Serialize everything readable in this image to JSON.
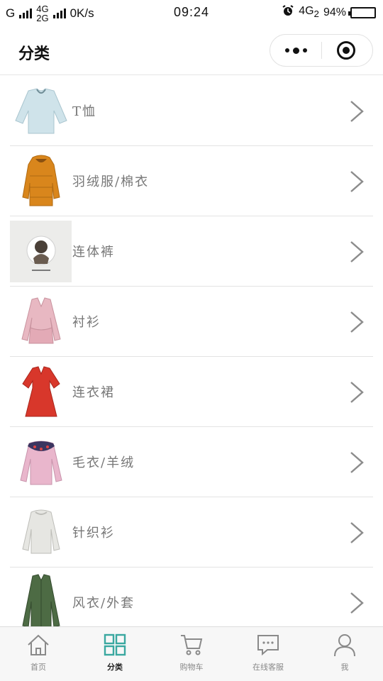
{
  "status_bar": {
    "carrier_left": "G",
    "net_top": "4G",
    "net_bottom": "2G",
    "speed": "0K/s",
    "time": "09:24",
    "net_right": "4G",
    "net_right_sub": "2",
    "battery_level": 0.94,
    "battery_text": "94%"
  },
  "header": {
    "title": "分类",
    "more_icon": "more-dots-icon",
    "close_icon": "target-close-icon"
  },
  "categories": [
    {
      "label": "T恤",
      "icon": "tshirt-thumbnail"
    },
    {
      "label": "羽绒服/棉衣",
      "icon": "down-jacket-thumbnail"
    },
    {
      "label": "连体裤",
      "icon": "jumpsuit-thumbnail"
    },
    {
      "label": "衬衫",
      "icon": "shirt-thumbnail"
    },
    {
      "label": "连衣裙",
      "icon": "dress-thumbnail"
    },
    {
      "label": "毛衣/羊绒",
      "icon": "sweater-thumbnail"
    },
    {
      "label": "针织衫",
      "icon": "knitwear-thumbnail"
    },
    {
      "label": "风衣/外套",
      "icon": "coat-thumbnail"
    }
  ],
  "tabbar": [
    {
      "label": "首页",
      "icon": "home-icon",
      "active": false
    },
    {
      "label": "分类",
      "icon": "category-grid-icon",
      "active": true
    },
    {
      "label": "购物车",
      "icon": "cart-icon",
      "active": false
    },
    {
      "label": "在线客服",
      "icon": "chat-icon",
      "active": false
    },
    {
      "label": "我",
      "icon": "profile-icon",
      "active": false
    }
  ],
  "colors": {
    "active_tab": "#3aa8a0",
    "inactive_tab": "#8a8a8a",
    "label_text": "#777777",
    "divider": "#e3e3e3"
  }
}
